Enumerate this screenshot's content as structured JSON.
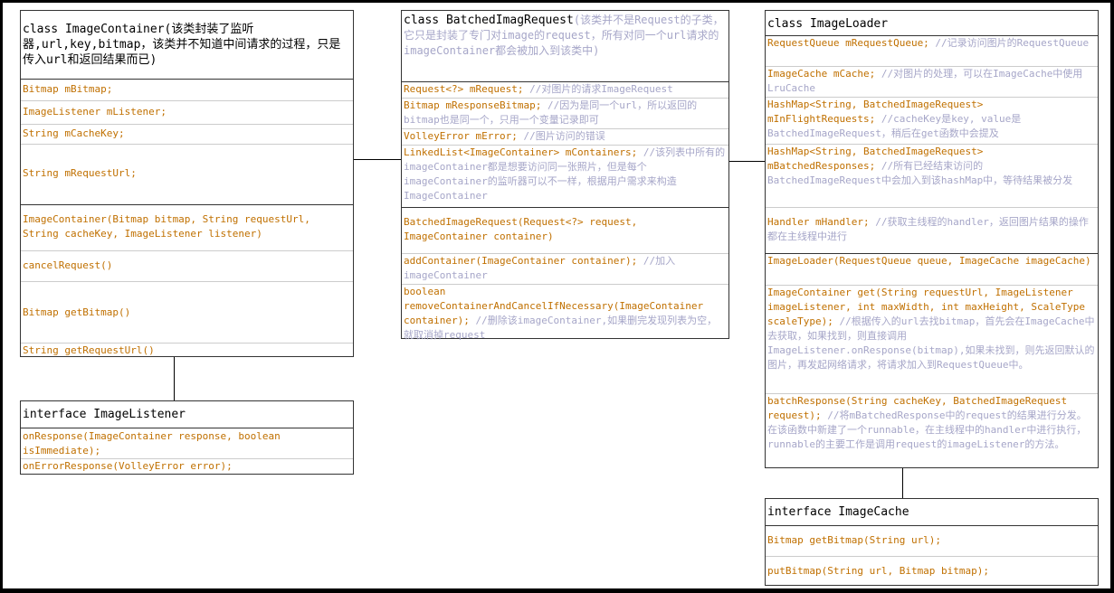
{
  "image_container": {
    "title": "class ImageContainer(该类封装了监听器,url,key,bitmap，该类并不知道中间请求的过程，只是传入url和返回结果而已)",
    "fields": [
      {
        "code": "Bitmap mBitmap;",
        "comment": ""
      },
      {
        "code": "ImageListener mListener;",
        "comment": ""
      },
      {
        "code": "String mCacheKey;",
        "comment": ""
      },
      {
        "code": "String mRequestUrl;",
        "comment": ""
      }
    ],
    "methods": [
      {
        "code": "ImageContainer(Bitmap bitmap, String requestUrl, String cacheKey, ImageListener listener)",
        "comment": ""
      },
      {
        "code": "cancelRequest()",
        "comment": ""
      },
      {
        "code": "Bitmap getBitmap()",
        "comment": ""
      },
      {
        "code": "String getRequestUrl()",
        "comment": ""
      }
    ]
  },
  "image_listener": {
    "title": "interface ImageListener",
    "methods": [
      {
        "code": "onResponse(ImageContainer response, boolean isImmediate);",
        "comment": ""
      },
      {
        "code": "onErrorResponse(VolleyError error);",
        "comment": ""
      }
    ]
  },
  "batched_request": {
    "title": "class BatchedImagRequest",
    "title_comment": "(该类并不是Request的子类，它只是封装了专门对image的request，所有对同一个url请求的imageContainer都会被加入到该类中)",
    "fields": [
      {
        "code": "Request<?> mRequest;",
        "comment": " //对图片的请求ImageRequest"
      },
      {
        "code": "Bitmap mResponseBitmap;",
        "comment": " //因为是同一个url，所以返回的bitmap也是同一个，只用一个变量记录即可"
      },
      {
        "code": "VolleyError mError;",
        "comment": " //图片访问的错误"
      },
      {
        "code": "LinkedList<ImageContainer> mContainers;",
        "comment": " //该列表中所有的imageContainer都是想要访问同一张照片，但是每个imageContainer的监听器可以不一样，根据用户需求来构造ImageContainer"
      }
    ],
    "methods": [
      {
        "code": "BatchedImageRequest(Request<?> request, ImageContainer container)",
        "comment": ""
      },
      {
        "code": "addContainer(ImageContainer container);",
        "comment": " //加入imageContainer"
      },
      {
        "code": "boolean removeContainerAndCancelIfNecessary(ImageContainer container);",
        "comment": " //删除该imageContainer,如果删完发现列表为空，就取消掉request"
      }
    ]
  },
  "image_loader": {
    "title": "class ImageLoader",
    "fields": [
      {
        "code": "RequestQueue mRequestQueue;",
        "comment": " //记录访问图片的RequestQueue"
      },
      {
        "code": "ImageCache mCache;",
        "comment": " //对图片的处理，可以在ImageCache中使用LruCache"
      },
      {
        "code": "HashMap<String, BatchedImageRequest> mInFlightRequests;",
        "comment": " //cacheKey是key, value是BatchedImageRequest，稍后在get函数中会提及"
      },
      {
        "code": "HashMap<String, BatchedImageRequest> mBatchedResponses;",
        "comment": " //所有已经结束访问的BatchedImageRequest中会加入到该hashMap中，等待结果被分发"
      },
      {
        "code": "Handler mHandler;",
        "comment": " //获取主线程的handler，返回图片结果的操作都在主线程中进行"
      }
    ],
    "methods": [
      {
        "code": "ImageLoader(RequestQueue queue, ImageCache imageCache)",
        "comment": ""
      },
      {
        "code": "ImageContainer get(String requestUrl, ImageListener imageListener, int maxWidth, int maxHeight, ScaleType scaleType);",
        "comment": " //根据传入的url去找bitmap，首先会在ImageCache中去获取，如果找到，则直接调用ImageListener.onResponse(bitmap),如果未找到，则先返回默认的图片，再发起网络请求，将请求加入到RequestQueue中。"
      },
      {
        "code": "batchResponse(String cacheKey, BatchedImageRequest request);",
        "comment": " //将mBatchedResponse中的request的结果进行分发。在该函数中新建了一个runnable，在主线程中的handler中进行执行，runnable的主要工作是调用request的imageListener的方法。"
      }
    ]
  },
  "image_cache": {
    "title": "interface ImageCache",
    "methods": [
      {
        "code": "Bitmap getBitmap(String url);",
        "comment": ""
      },
      {
        "code": "putBitmap(String url, Bitmap bitmap);",
        "comment": ""
      }
    ]
  }
}
